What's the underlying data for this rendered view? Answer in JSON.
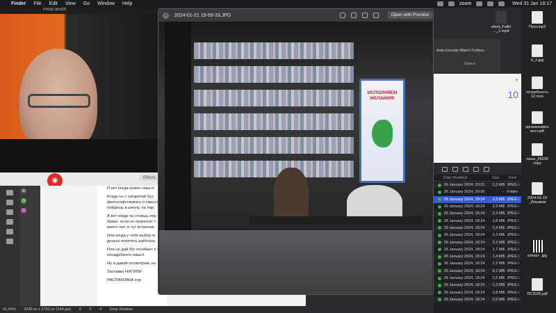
{
  "menubar": {
    "items": [
      "Finder",
      "File",
      "Edit",
      "View",
      "Go",
      "Window",
      "Help"
    ],
    "zoom": "zoom",
    "clock": "Wed 31 Jan  18:17"
  },
  "photobooth": {
    "title": "Photo Booth",
    "effects": "Effects"
  },
  "quicklook": {
    "filename": "2024-01-21 19-59-33.JPG",
    "open_with": "Open with Preview",
    "poster_text": "ИСПОЛНЯЕМ\nЖЕЛАНИЯ!"
  },
  "side_panel": {
    "encode": "Auto-Encode Watch Folders",
    "status": "Status",
    "calendar_num": "10"
  },
  "desktop_icons": [
    {
      "label": "short_FullH\n..._1.mp4"
    },
    {
      "label": "Пуск.mp3"
    },
    {
      "label": "6_2.jpg"
    },
    {
      "label": "потребность\n12.mov"
    },
    {
      "label": "организовать\nинст.pdf"
    },
    {
      "label": "паны_20230\nсору"
    },
    {
      "label": "2024-01-19\n_Ильиков"
    },
    {
      "label": "school-\n.jpg"
    },
    {
      "label": "ПС2025.pdf"
    }
  ],
  "finder": {
    "col_date": "Date Modified",
    "col_size": "Size",
    "col_kind": "Kind",
    "rows": [
      {
        "date": "26 January 2024, 20:31",
        "size": "2,3 MB",
        "kind": "JPEG i"
      },
      {
        "date": "26 January 2024, 20:30",
        "size": "--",
        "kind": "Folder"
      },
      {
        "date": "26 January 2024, 18:24",
        "size": "2,8 MB",
        "kind": "JPEG i"
      },
      {
        "date": "26 January 2024, 18:24",
        "size": "2,9 MB",
        "kind": "JPEG i"
      },
      {
        "date": "26 January 2024, 18:24",
        "size": "2,3 MB",
        "kind": "JPEG i"
      },
      {
        "date": "26 January 2024, 18:24",
        "size": "1,8 MB",
        "kind": "JPEG i"
      },
      {
        "date": "26 January 2024, 18:24",
        "size": "2,4 MB",
        "kind": "JPEG i"
      },
      {
        "date": "26 January 2024, 18:24",
        "size": "2,3 MB",
        "kind": "JPEG i"
      },
      {
        "date": "26 January 2024, 18:24",
        "size": "2,2 MB",
        "kind": "JPEG i"
      },
      {
        "date": "26 January 2024, 18:24",
        "size": "1,7 MB",
        "kind": "JPEG i"
      },
      {
        "date": "26 January 2024, 18:24",
        "size": "1,4 MB",
        "kind": "JPEG i"
      },
      {
        "date": "26 January 2024, 18:24",
        "size": "2,2 MB",
        "kind": "JPEG i"
      },
      {
        "date": "26 January 2024, 18:24",
        "size": "5,1 MB",
        "kind": "JPEG i"
      },
      {
        "date": "26 January 2024, 18:24",
        "size": "2,5 MB",
        "kind": "JPEG i"
      },
      {
        "date": "26 January 2024, 18:24",
        "size": "2,3 MB",
        "kind": "JPEG i"
      },
      {
        "date": "26 January 2024, 18:24",
        "size": "2,8 MB",
        "kind": "JPEG i"
      },
      {
        "date": "26 January 2024, 18:24",
        "size": "2,5 MB",
        "kind": "JPEG i"
      }
    ]
  },
  "document": {
    "para1": "И вот когда нужен смысл.",
    "para2": "Когда ты с сигаретой бух философствовать о смысле пойдешь в школу, на пар",
    "para3": "А вот когда ты стоишь пер браке, если он приносит т много лет, и тут встречае",
    "para4": "Или когда у тебя выбор м деньги полететь работать",
    "para5": "Или не дай бог погибает к тоже понадобится смысл",
    "para6": "Ну и давай посмотрим, ка",
    "para7": "Заставка НИГИЛИ",
    "para8": "РАСПАКОВКА кор",
    "zoom": "61,54%",
    "dims": "3240 px x 2782 px (144 ppi)",
    "counters": [
      "0",
      "0",
      "4"
    ],
    "drop_shadow": "Drop Shadow"
  }
}
